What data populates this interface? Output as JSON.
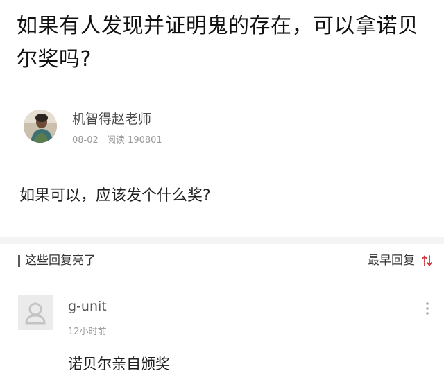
{
  "question": {
    "title": "如果有人发现并证明鬼的存在，可以拿诺贝尔奖吗?",
    "body": "如果可以，应该发个什么奖?"
  },
  "author": {
    "name": "机智得赵老师",
    "date": "08-02",
    "reads": "阅读 190801"
  },
  "replies_section": {
    "title": "这些回复亮了",
    "sort_label": "最早回复",
    "sort_icon": "sort-arrows-icon"
  },
  "comments": [
    {
      "username": "g-unit",
      "time": "12小时前",
      "text": "诺贝尔亲自颁奖",
      "more_icon": "more-vertical-icon"
    }
  ],
  "colors": {
    "accent": "#d2323c",
    "muted_text": "#999999",
    "divider": "#f4f4f4"
  }
}
